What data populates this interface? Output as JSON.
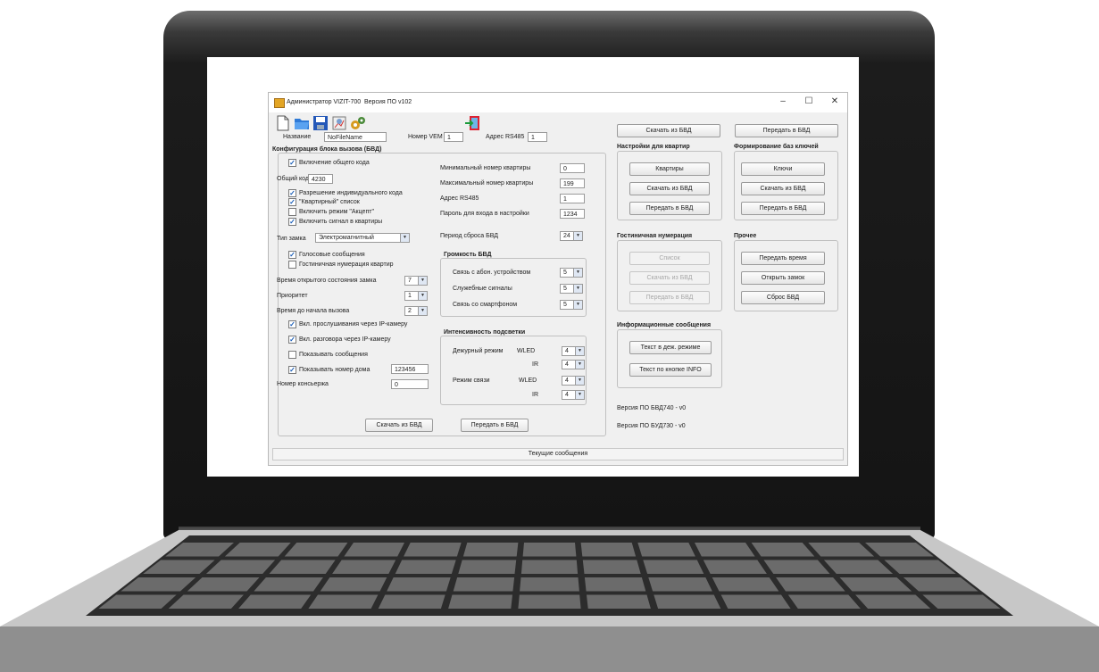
{
  "window": {
    "title": "Администратор VIZIT-700",
    "version": "Версия ПО v102",
    "controls": {
      "minimize": "–",
      "maximize": "☐",
      "close": "✕"
    }
  },
  "toolbar": {
    "icons": [
      "new-file-icon",
      "open-folder-icon",
      "save-icon",
      "print-settings-icon",
      "gears-icon",
      "exit-door-icon"
    ]
  },
  "header": {
    "name_label": "Название",
    "name_value": "NoFileName",
    "vem_label": "Номер VEM",
    "vem_value": "1",
    "rs485_label": "Адрес RS485",
    "rs485_value": "1"
  },
  "config": {
    "title": "Конфигурация блока вызова (БВД)",
    "common_code_enable": "Включение общего кода",
    "common_code_label": "Общий код",
    "common_code_value": "4230",
    "individual_code": "Разрешение индивидуального кода",
    "apartment_list": "\"Квартирный\" список",
    "accept_mode": "Включить режим \"Акцепт\"",
    "signal_apartment": "Включить сигнал в квартиры",
    "lock_type_label": "Тип замка",
    "lock_type_value": "Электромагнитный",
    "voice_messages": "Голосовые сообщения",
    "hotel_numbering": "Гостиничная нумерация квартир",
    "open_time_label": "Время открытого состояния замка",
    "open_time_value": "7",
    "priority_label": "Приоритет",
    "priority_value": "1",
    "call_delay_label": "Время до начала вызова",
    "call_delay_value": "2",
    "ip_listen": "Вкл. прослушивания через IP-камеру",
    "ip_talk": "Вкл. разговора через IP-камеру",
    "show_messages": "Показывать сообщения",
    "show_house": "Показывать номер дома",
    "house_value": "123456",
    "concierge_label": "Номер консьержа",
    "concierge_value": "0",
    "min_apt_label": "Минимальный номер квартиры",
    "min_apt_value": "0",
    "max_apt_label": "Максимальный номер квартиры",
    "max_apt_value": "199",
    "addr_label": "Адрес RS485",
    "addr_value": "1",
    "pwd_label": "Пароль для входа в настройки",
    "pwd_value": "1234",
    "reset_label": "Период сброса БВД",
    "reset_value": "24",
    "download_btn": "Скачать из БВД",
    "upload_btn": "Передать в БВД"
  },
  "volume": {
    "title": "Громкость БВД",
    "subscriber_label": "Связь с абон. устройством",
    "subscriber_value": "5",
    "service_label": "Служебные сигналы",
    "service_value": "5",
    "smartphone_label": "Связь со смартфоном",
    "smartphone_value": "5"
  },
  "backlight": {
    "title": "Интенсивность подсветки",
    "duty_label": "Дежурный режим",
    "wled": "WLED",
    "ir": "IR",
    "duty_wled": "4",
    "duty_ir": "4",
    "call_label": "Режим связи",
    "call_wled": "4",
    "call_ir": "4"
  },
  "right": {
    "download_top": "Скачать из БВД",
    "upload_top": "Передать в БВД",
    "apartments_title": "Настройки для квартир",
    "apartments_btn": "Квартиры",
    "apt_download": "Скачать из БВД",
    "apt_upload": "Передать в БВД",
    "keys_title": "Формирование баз ключей",
    "keys_btn": "Ключи",
    "keys_download": "Скачать из БВД",
    "keys_upload": "Передать в БВД",
    "hotel_title": "Гостиничная нумерация",
    "hotel_list": "Список",
    "hotel_download": "Скачать из БВД",
    "hotel_upload": "Передать в БВД",
    "other_title": "Прочее",
    "send_time": "Передать время",
    "open_lock": "Открыть замок",
    "reset_bvd": "Сброс БВД",
    "info_title": "Информационные сообщения",
    "duty_text": "Текст в деж. режиме",
    "info_text": "Текст по кнопке INFO",
    "version_bvd": "Версия ПО БВД740 - v0",
    "version_bud": "Версия ПО БУД730 - v0"
  },
  "status": {
    "text": "Текущие сообщения"
  },
  "colors": {
    "accent": "#1b5fb8",
    "laptop_body": "#1a1a1a",
    "window_bg": "#f0f0f0"
  }
}
